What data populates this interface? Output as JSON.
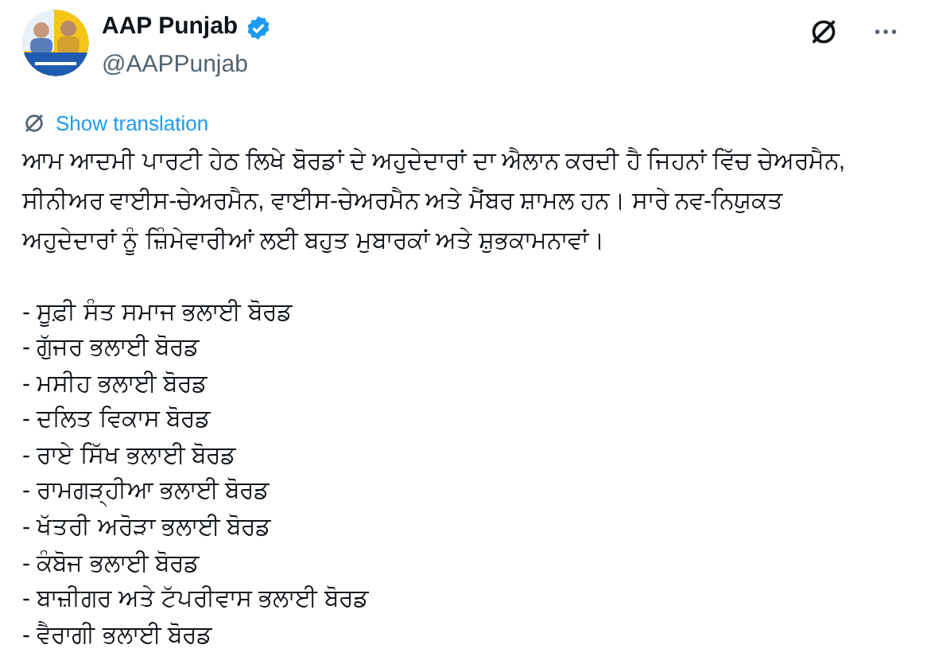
{
  "author": {
    "name": "AAP Punjab",
    "verified": true,
    "handle": "@AAPPunjab"
  },
  "translate_link": "Show translation",
  "body": "ਆਮ ਆਦਮੀ ਪਾਰਟੀ ਹੇਠ ਲਿਖੇ ਬੋਰਡਾਂ ਦੇ ਅਹੁਦੇਦਾਰਾਂ ਦਾ ਐਲਾਨ ਕਰਦੀ ਹੈ ਜਿਹਨਾਂ ਵਿੱਚ ਚੇਅਰਮੈਨ, ਸੀਨੀਅਰ ਵਾਈਸ-ਚੇਅਰਮੈਨ, ਵਾਈਸ-ਚੇਅਰਮੈਨ ਅਤੇ ਮੈਂਬਰ ਸ਼ਾਮਲ ਹਨ। ਸਾਰੇ ਨਵ-ਨਿਯੁਕਤ ਅਹੁਦੇਦਾਰਾਂ ਨੂੰ ਜ਼ਿੰਮੇਵਾਰੀਆਂ ਲਈ ਬਹੁਤ ਮੁਬਾਰਕਾਂ ਅਤੇ ਸ਼ੁਭਕਾਮਨਾਵਾਂ।",
  "boards": [
    "- ਸੂਫ਼ੀ ਸੰਤ ਸਮਾਜ ਭਲਾਈ ਬੋਰਡ",
    "- ਗੁੱਜਰ ਭਲਾਈ ਬੋਰਡ",
    "- ਮਸੀਹ ਭਲਾਈ ਬੋਰਡ",
    "- ਦਲਿਤ ਵਿਕਾਸ ਬੋਰਡ",
    "- ਰਾਏ ਸਿੱਖ ਭਲਾਈ ਬੋਰਡ",
    "- ਰਾਮਗੜ੍ਹੀਆ ਭਲਾਈ ਬੋਰਡ",
    "- ਖੱਤਰੀ ਅਰੋੜਾ ਭਲਾਈ ਬੋਰਡ",
    "- ਕੰਬੋਜ ਭਲਾਈ ਬੋਰਡ",
    "- ਬਾਜ਼ੀਗਰ ਅਤੇ ਟੱਪਰੀਵਾਸ ਭਲਾਈ ਬੋਰਡ",
    "- ਵੈਰਾਗੀ ਭਲਾਈ ਬੋਰਡ"
  ]
}
